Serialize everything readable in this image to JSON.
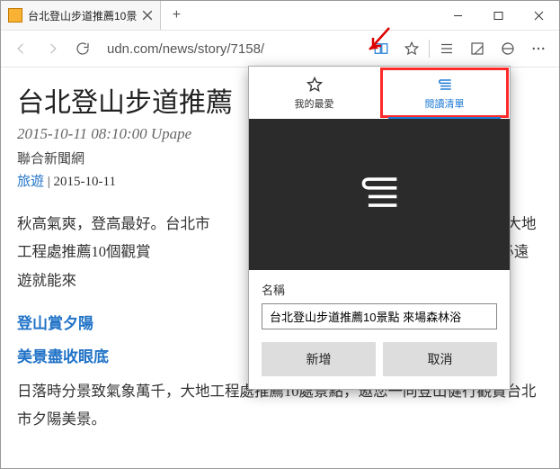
{
  "window": {
    "tab_title": "台北登山步道推薦10景",
    "url": "udn.com/news/story/7158/"
  },
  "article": {
    "title": "台北登山步道推薦",
    "timestamp": "2015-10-11 08:10:00 Upape",
    "source": "聯合新聞網",
    "category": "旅遊",
    "date": "2015-10-11",
    "para1": "秋高氣爽，登高最好。台北市　　　　　　　　　　　　　　　　府工務局大地工程處推薦10個觀賞　　　　　　　　　　　　　　的「台北小溪頭」，不必遠遊就能來",
    "h2a": "登山賞夕陽",
    "h2b": "美景盡收眼底",
    "para2": "日落時分景致氣象萬千，大地工程處推薦10處景點，邀您一同登山健行觀賞台北市夕陽美景。"
  },
  "flyout": {
    "tab_fav": "我的最愛",
    "tab_list": "閱讀清單",
    "name_label": "名稱",
    "name_value": "台北登山步道推薦10景點 來場森林浴",
    "add": "新增",
    "cancel": "取消"
  }
}
